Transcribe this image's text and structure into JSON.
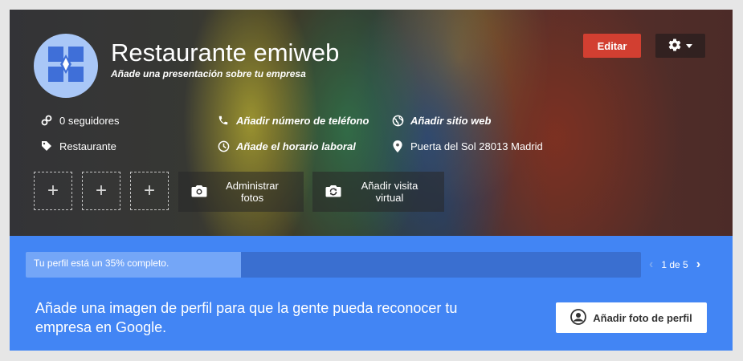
{
  "header": {
    "business_name": "Restaurante emiweb",
    "subtitle": "Añade una presentación sobre tu empresa",
    "edit_label": "Editar"
  },
  "info": {
    "followers": "0 seguidores",
    "phone": "Añadir número de teléfono",
    "website": "Añadir sitio web",
    "category": "Restaurante",
    "hours": "Añade el horario laboral",
    "address": "Puerta del Sol 28013 Madrid"
  },
  "photos": {
    "placeholder_symbol": "+",
    "manage_label": "Administrar fotos",
    "virtual_tour_label": "Añadir visita virtual"
  },
  "progress": {
    "text": "Tu perfil está un 35% completo.",
    "percent": 35,
    "pager": "1 de 5",
    "prev_symbol": "‹",
    "next_symbol": "›"
  },
  "prompt": {
    "message": "Añade una imagen de perfil para que la gente pueda reconocer tu empresa en Google.",
    "button_label": "Añadir foto de perfil"
  },
  "colors": {
    "edit_button": "#d23f31",
    "blue_panel": "#4285f4",
    "avatar_bg": "#a9c7f7"
  },
  "icons": [
    "building-icon",
    "gear-icon",
    "caret-down-icon",
    "link-icon",
    "phone-icon",
    "globe-icon",
    "tag-icon",
    "clock-icon",
    "location-pin-icon",
    "camera-icon",
    "refresh-camera-icon",
    "account-circle-icon"
  ]
}
